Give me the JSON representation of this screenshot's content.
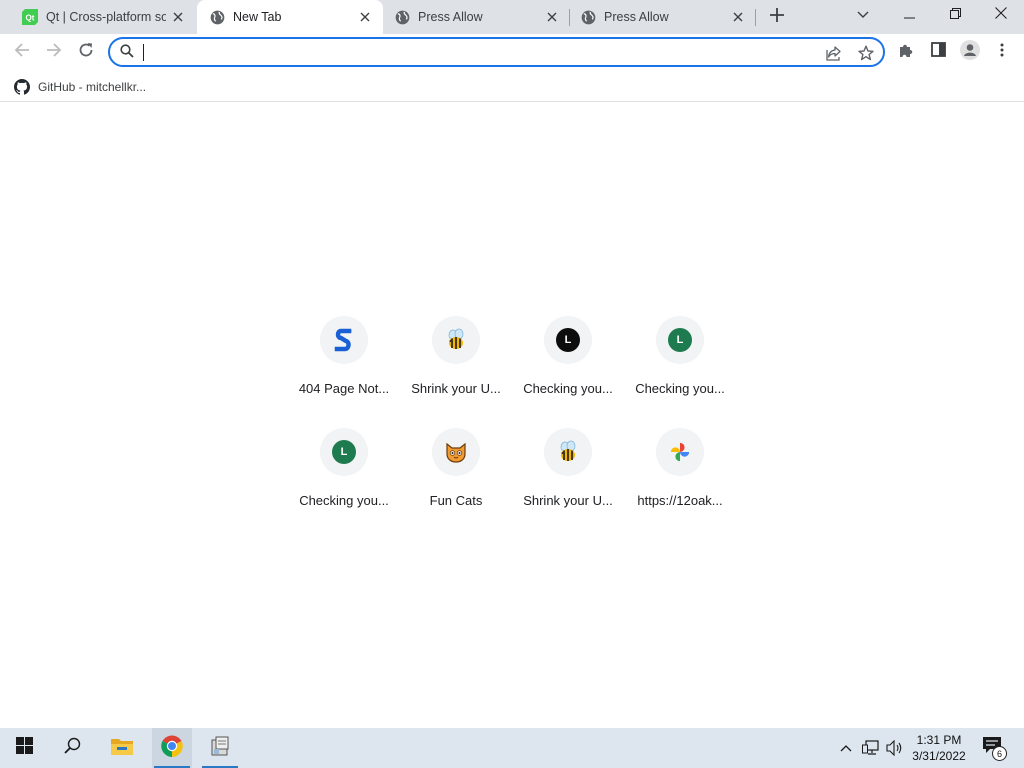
{
  "browser": {
    "tabs": [
      {
        "title": "Qt | Cross-platform sof",
        "icon": "qt-icon",
        "active": false
      },
      {
        "title": "New Tab",
        "icon": "globe-icon",
        "active": true
      },
      {
        "title": "Press Allow",
        "icon": "globe-icon",
        "active": false
      },
      {
        "title": "Press Allow",
        "icon": "globe-icon",
        "active": false
      }
    ],
    "qt_logo_text": "Qt",
    "omnibox": {
      "value": "",
      "placeholder": ""
    },
    "accent_color": "#1a73e8"
  },
  "bookmarks": [
    {
      "label": "GitHub - mitchellkr...",
      "icon": "github-icon"
    }
  ],
  "shortcuts": [
    {
      "label": "404 Page Not...",
      "icon": "blue-s-icon"
    },
    {
      "label": "Shrink your U...",
      "icon": "bee-icon"
    },
    {
      "label": "Checking you...",
      "icon": "letter-l-black-icon",
      "letter": "L"
    },
    {
      "label": "Checking you...",
      "icon": "letter-l-green-icon",
      "letter": "L"
    },
    {
      "label": "Checking you...",
      "icon": "letter-l-green-icon",
      "letter": "L"
    },
    {
      "label": "Fun Cats",
      "icon": "cat-icon"
    },
    {
      "label": "Shrink your U...",
      "icon": "bee-icon"
    },
    {
      "label": "https://12oak...",
      "icon": "pinwheel-icon"
    }
  ],
  "taskbar": {
    "time": "1:31 PM",
    "date": "3/31/2022",
    "notification_count": "6"
  }
}
